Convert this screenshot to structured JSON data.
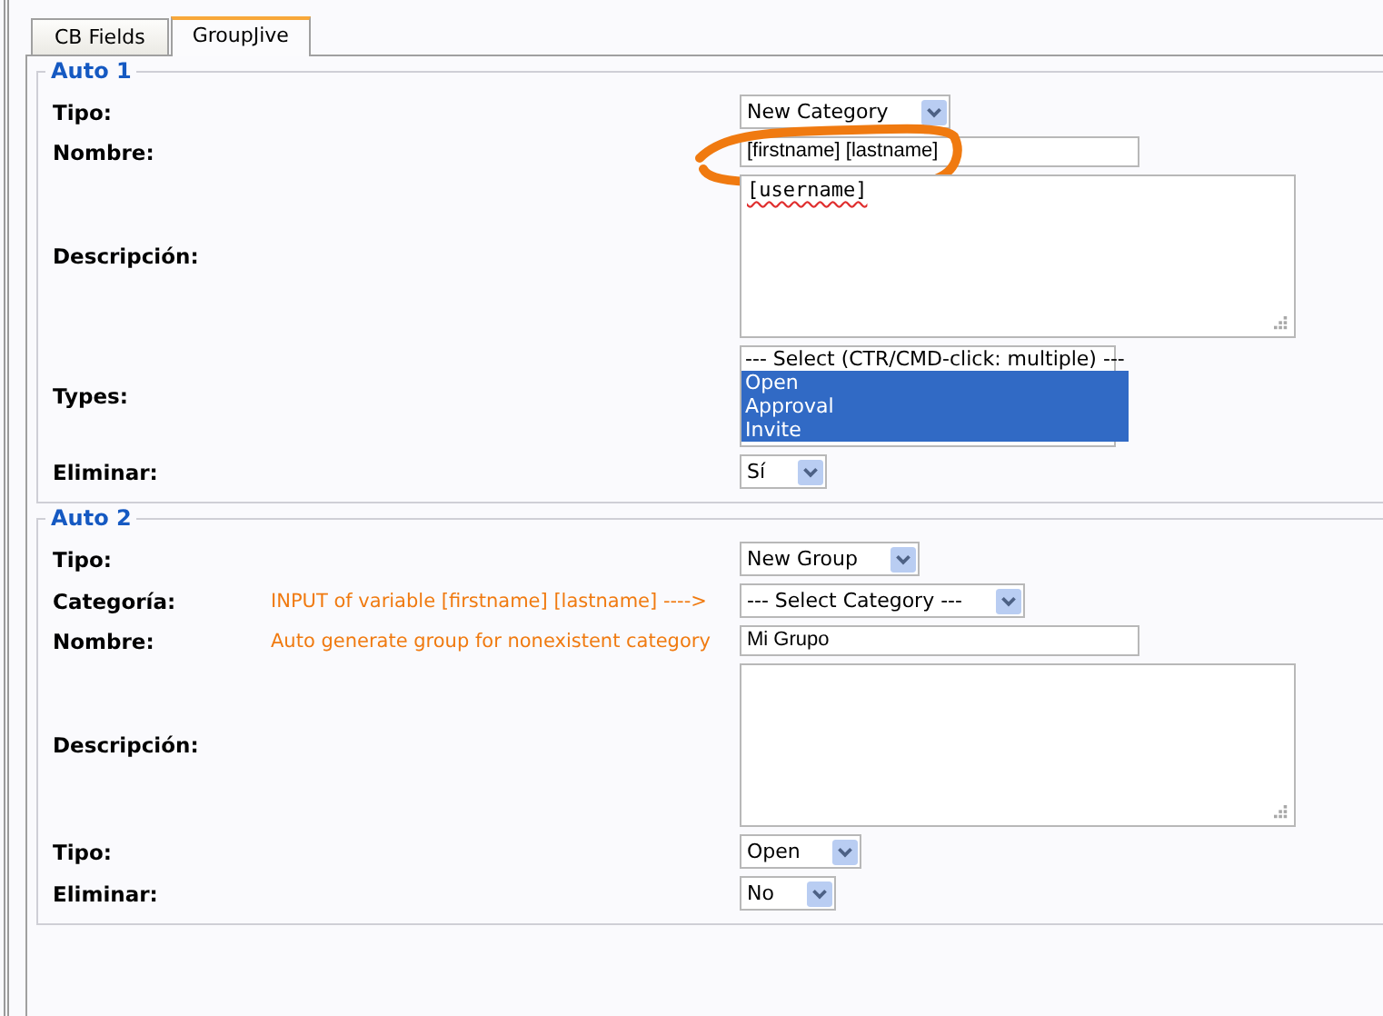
{
  "tabs": [
    {
      "label": "CB Fields",
      "selected": false
    },
    {
      "label": "GroupJive",
      "selected": true
    }
  ],
  "fieldsets": [
    {
      "legend": "Auto 1",
      "rows": [
        {
          "kind": "select",
          "label": "Tipo:",
          "value": "New Category"
        },
        {
          "kind": "text",
          "label": "Nombre:",
          "value": "[firstname] [lastname]",
          "highlighted": true
        },
        {
          "kind": "textarea",
          "label": "Descripción:",
          "value": "[username]"
        },
        {
          "kind": "multiselect",
          "label": "Types:",
          "options": [
            {
              "label": "--- Select (CTR/CMD-click: multiple) ---",
              "selected": false
            },
            {
              "label": "Open",
              "selected": true
            },
            {
              "label": "Approval",
              "selected": true
            },
            {
              "label": "Invite",
              "selected": true
            }
          ]
        },
        {
          "kind": "select",
          "label": "Eliminar:",
          "value": "Sí"
        }
      ]
    },
    {
      "legend": "Auto 2",
      "rows": [
        {
          "kind": "select",
          "label": "Tipo:",
          "value": "New Group"
        },
        {
          "kind": "select",
          "label": "Categoría:",
          "value": "--- Select Category ---",
          "note": "INPUT of variable [firstname] [lastname] ---->"
        },
        {
          "kind": "text",
          "label": "Nombre:",
          "value": "Mi Grupo",
          "note": "Auto generate group for nonexistent category"
        },
        {
          "kind": "textarea",
          "label": "Descripción:",
          "value": ""
        },
        {
          "kind": "select",
          "label": "Tipo:",
          "value": "Open"
        },
        {
          "kind": "select",
          "label": "Eliminar:",
          "value": "No"
        }
      ]
    }
  ]
}
